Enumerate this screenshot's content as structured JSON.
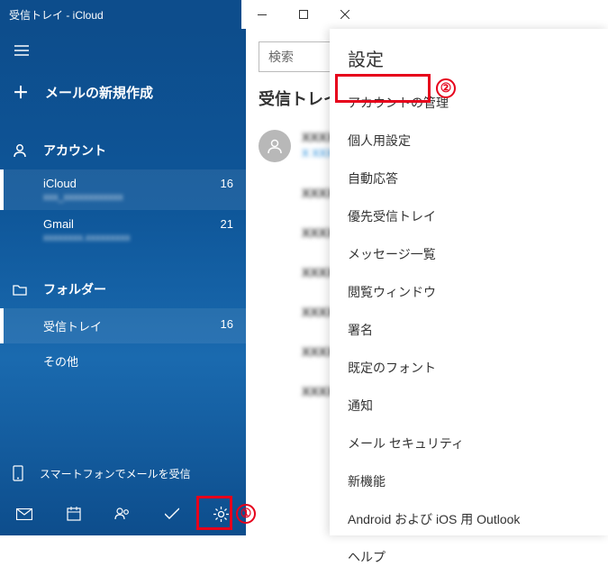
{
  "titlebar": {
    "title": "受信トレイ - iCloud"
  },
  "sidebar": {
    "compose": "メールの新規作成",
    "accounts_label": "アカウント",
    "accounts": [
      {
        "name": "iCloud",
        "count": "16",
        "sub": "xxx_xxxxxxxxxxxx"
      },
      {
        "name": "Gmail",
        "count": "21",
        "sub": "xxxxxxxx.xxxxxxxxx"
      }
    ],
    "folders_label": "フォルダー",
    "folders": [
      {
        "name": "受信トレイ",
        "count": "16"
      },
      {
        "name": "その他",
        "count": ""
      }
    ],
    "phone": "スマートフォンでメールを受信"
  },
  "content": {
    "search_placeholder": "検索",
    "list_header": "受信トレイ",
    "msg1_l1": "XXXXX XX",
    "msg1_l2": "X XXXX",
    "msgs": [
      "XXXXXX",
      "XXXXX",
      "XXXXXX",
      "XXXXXXX",
      "XXXXX",
      "XXXXXXX"
    ]
  },
  "settings": {
    "title": "設定",
    "items": [
      "アカウントの管理",
      "個人用設定",
      "自動応答",
      "優先受信トレイ",
      "メッセージ一覧",
      "閲覧ウィンドウ",
      "署名",
      "既定のフォント",
      "通知",
      "メール セキュリティ",
      "新機能",
      "Android および iOS 用 Outlook",
      "ヘルプ"
    ]
  },
  "markers": {
    "m1": "①",
    "m2": "②"
  }
}
